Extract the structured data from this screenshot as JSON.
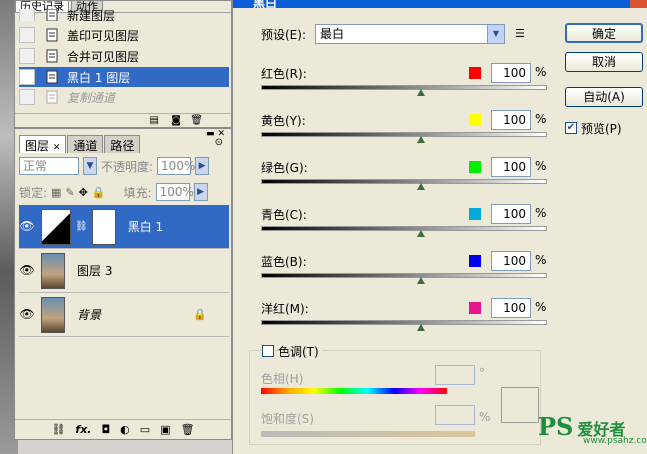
{
  "history": {
    "tabs": [
      "历史记录",
      "动作"
    ],
    "items": [
      {
        "label": "新建图层",
        "state": "partial"
      },
      {
        "label": "盖印可见图层",
        "state": "normal"
      },
      {
        "label": "合并可见图层",
        "state": "normal"
      },
      {
        "label": "黑白 1 图层",
        "state": "selected"
      },
      {
        "label": "复制通道",
        "state": "dim"
      }
    ]
  },
  "layers": {
    "tabs": [
      "图层",
      "通道",
      "路径"
    ],
    "blend_mode": "正常",
    "opacity_label": "不透明度:",
    "opacity_value": "100%",
    "lock_label": "锁定:",
    "fill_label": "填充:",
    "fill_value": "100%",
    "items": [
      {
        "name": "黑白 1",
        "selected": true
      },
      {
        "name": "图层 3",
        "selected": false
      },
      {
        "name": "背景",
        "selected": false
      }
    ],
    "bottom_icons": [
      "link-icon",
      "fx-icon",
      "mask-icon",
      "adjustment-icon",
      "folder-icon",
      "new-layer-icon",
      "trash-icon"
    ],
    "fx_label": "fx."
  },
  "dialog": {
    "title": "黑白",
    "preset_label": "预设(E):",
    "preset_value": "最白",
    "sliders": [
      {
        "label": "红色(R):",
        "color": "#ff0000",
        "value": "100",
        "pos": 0.56
      },
      {
        "label": "黄色(Y):",
        "color": "#ffff00",
        "value": "100",
        "pos": 0.56
      },
      {
        "label": "绿色(G):",
        "color": "#00ee00",
        "value": "100",
        "pos": 0.56
      },
      {
        "label": "青色(C):",
        "color": "#00aadd",
        "value": "100",
        "pos": 0.56
      },
      {
        "label": "蓝色(B):",
        "color": "#0000ee",
        "value": "100",
        "pos": 0.56
      },
      {
        "label": "洋红(M):",
        "color": "#e8158c",
        "value": "100",
        "pos": 0.56
      }
    ],
    "percent": "%",
    "buttons": {
      "ok": "确定",
      "cancel": "取消",
      "auto": "自动(A)"
    },
    "preview_label": "预览(P)",
    "tint_label": "色调(T)",
    "hue_label": "色相(H)",
    "sat_label": "饱和度(S)",
    "degree": "°"
  },
  "watermark": {
    "brand": "PS",
    "text": "爱好者",
    "url": "www.psahz.com"
  }
}
